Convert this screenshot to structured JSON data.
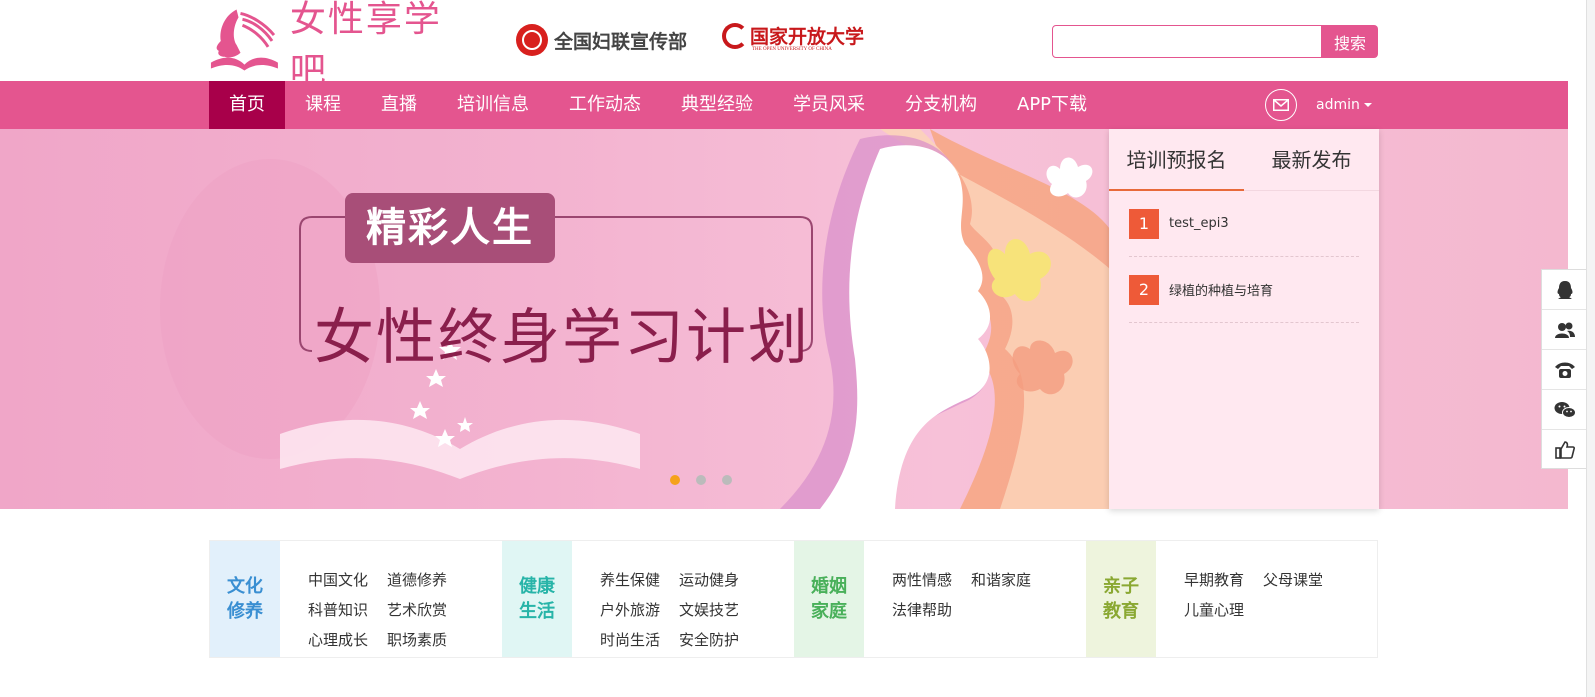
{
  "header": {
    "logo_text": "女性享学吧",
    "partner1": "全国妇联宣传部",
    "partner2": "国家开放大学",
    "partner2_sub": "THE OPEN UNIVERSITY OF CHINA",
    "search": {
      "placeholder": "",
      "value": "",
      "button": "搜索"
    }
  },
  "nav": {
    "items": [
      "首页",
      "课程",
      "直播",
      "培训信息",
      "工作动态",
      "典型经验",
      "学员风采",
      "分支机构",
      "APP下载"
    ],
    "user": "admin"
  },
  "banner": {
    "badge": "精彩人生",
    "title": "女性终身学习计划",
    "active_slide": 1,
    "slide_count": 3,
    "active_dot_color": "#f5a21b"
  },
  "panel": {
    "tabs": [
      "培训预报名",
      "最新发布"
    ],
    "active_tab": 0,
    "items": [
      {
        "num": "1",
        "text": "test_epi3"
      },
      {
        "num": "2",
        "text": "绿植的种植与培育"
      }
    ]
  },
  "tools": [
    "qq-icon",
    "group-icon",
    "phone-icon",
    "wechat-icon",
    "thumbs-up-icon"
  ],
  "categories": [
    {
      "title_1": "文化",
      "title_2": "修养",
      "color": "#3a8fd2",
      "bg": "#e2f0fb",
      "links": [
        "中国文化",
        "道德修养",
        "科普知识",
        "艺术欣赏",
        "心理成长",
        "职场素质"
      ]
    },
    {
      "title_1": "健康",
      "title_2": "生活",
      "color": "#27b4a8",
      "bg": "#e0f6f4",
      "links": [
        "养生保健",
        "运动健身",
        "户外旅游",
        "文娱技艺",
        "时尚生活",
        "安全防护"
      ]
    },
    {
      "title_1": "婚姻",
      "title_2": "家庭",
      "color": "#49b05a",
      "bg": "#e4f5e6",
      "links": [
        "两性情感",
        "和谐家庭",
        "法律帮助"
      ]
    },
    {
      "title_1": "亲子",
      "title_2": "教育",
      "color": "#8aa832",
      "bg": "#eef4dd",
      "links": [
        "早期教育",
        "父母课堂",
        "儿童心理"
      ]
    }
  ],
  "colors": {
    "brand": "#e4558f",
    "nav_active": "#a8004a",
    "badge_num": "#ee5a38"
  }
}
